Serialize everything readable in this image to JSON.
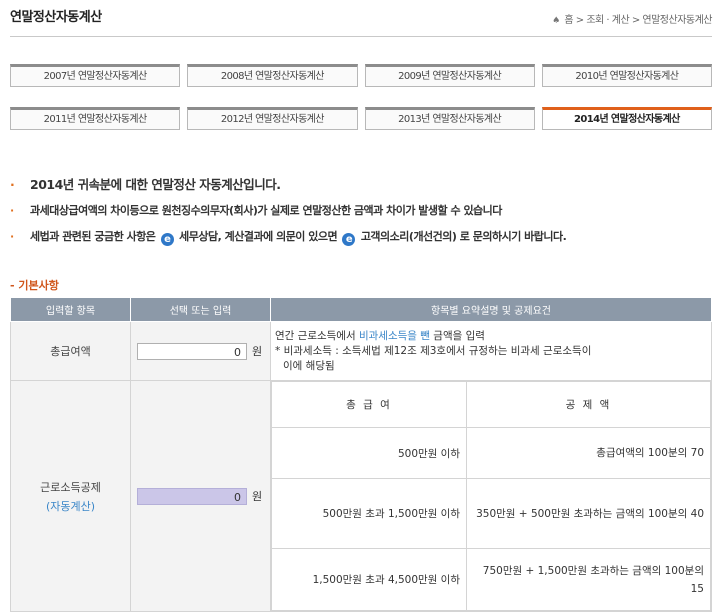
{
  "header": {
    "title": "연말정산자동계산",
    "breadcrumb": {
      "home": "홈",
      "path": "> 조회 · 계산 > 연말정산자동계산"
    }
  },
  "tabs_row1": [
    "2007년 연말정산자동계산",
    "2008년 연말정산자동계산",
    "2009년 연말정산자동계산",
    "2010년 연말정산자동계산"
  ],
  "tabs_row2": [
    "2011년 연말정산자동계산",
    "2012년 연말정산자동계산",
    "2013년 연말정산자동계산",
    "2014년 연말정산자동계산"
  ],
  "notes": {
    "n1": "2014년 귀속분에 대한 연말정산 자동계산입니다.",
    "n2": "과세대상급여액의 차이등으로 원천징수의무자(회사)가 실제로 연말정산한 금액과 차이가 발생할 수 있습니다",
    "n3_a": "세법과 관련된 궁금한 사항은",
    "n3_link1": "세무상담,",
    "n3_b": "계산결과에 의문이 있으면",
    "n3_link2": "고객의소리(개선건의)",
    "n3_c": "로 문의하시기 바랍니다."
  },
  "section_title": "- 기본사항",
  "table": {
    "headers": [
      "입력할 항목",
      "선택 또는 입력",
      "항목별 요약설명 및 공제요건"
    ],
    "row1": {
      "label": "총급여액",
      "value": "0",
      "unit": "원",
      "desc_a": "연간 근로소득에서",
      "desc_hl": "비과세소득을 뺀",
      "desc_b": "금액을 입력",
      "desc2": "* 비과세소득 : 소득세법 제12조 제3호에서 규정하는 비과세 근로소득이",
      "desc3": "이에 해당됨"
    },
    "row2": {
      "label": "근로소득공제",
      "sublabel": "(자동계산)",
      "value": "0",
      "unit": "원",
      "inner_headers": [
        "총 급 여",
        "공 제 액"
      ],
      "inner_rows": [
        [
          "500만원 이하",
          "총급여액의 100분의 70"
        ],
        [
          "500만원 초과 1,500만원 이하",
          "350만원 + 500만원 초과하는 금액의 100분의 40"
        ],
        [
          "1,500만원 초과 4,500만원 이하",
          "750만원 + 1,500만원 초과하는 금액의 100분의 15"
        ]
      ]
    }
  },
  "colors": {
    "accent": "#e0601b",
    "header_bg": "#8c99a8",
    "link": "#3a86c8",
    "auto_input": "#cbc6e8"
  }
}
